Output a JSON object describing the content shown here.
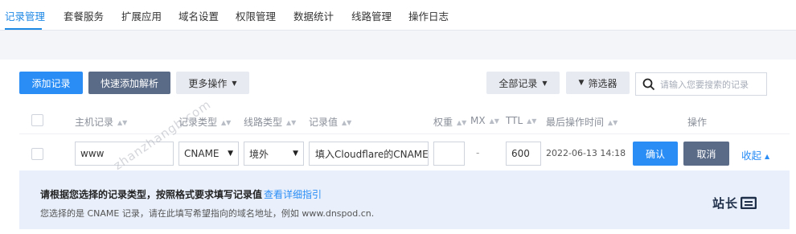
{
  "tabs": [
    "记录管理",
    "套餐服务",
    "扩展应用",
    "域名设置",
    "权限管理",
    "数据统计",
    "线路管理",
    "操作日志"
  ],
  "toolbar": {
    "add_record": "添加记录",
    "quick_add": "快速添加解析",
    "more_actions": "更多操作",
    "all_records": "全部记录",
    "filter": "筛选器",
    "search_placeholder": "请输入您要搜索的记录"
  },
  "columns": {
    "host": "主机记录",
    "type": "记录类型",
    "line": "线路类型",
    "value": "记录值",
    "weight": "权重",
    "mx": "MX",
    "ttl": "TTL",
    "last_op": "最后操作时间",
    "actions": "操作"
  },
  "edit_row": {
    "host": "www",
    "type": "CNAME",
    "line": "境外",
    "value": "填入Cloudflare的CNAME",
    "weight": "",
    "mx": "-",
    "ttl": "600",
    "time": "2022-06-13 14:18",
    "confirm": "确认",
    "cancel": "取消",
    "collapse": "收起"
  },
  "hint": {
    "title": "请根据您选择的记录类型，按照格式要求填写记录值",
    "link": "查看详细指引",
    "desc": "您选择的是 CNAME 记录，请在此填写希望指向的域名地址，例如 www.dnspod.cn.",
    "logo": "站长"
  },
  "watermark": "zhanzhangb.com",
  "colors": {
    "accent": "#2a8df5",
    "dark_button": "#5a6b87",
    "hint_bg": "#e9f0fb"
  }
}
